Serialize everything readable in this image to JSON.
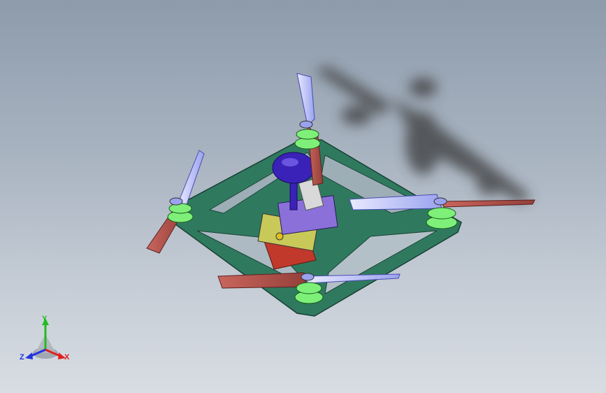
{
  "triad": {
    "x_label": "X",
    "y_label": "Y",
    "z_label": "Z",
    "x_color": "#e02020",
    "y_color": "#22bb22",
    "z_color": "#2233dd"
  },
  "colors": {
    "frame": "#2f7a5f",
    "frame_edge": "#1a3f33",
    "motor": "#7ef07a",
    "prop_red": "#b8524a",
    "prop_blue": "#b7bdf3",
    "antenna": "#3a22b8",
    "camera": "#8a70d8",
    "battery": "#c0392b"
  }
}
